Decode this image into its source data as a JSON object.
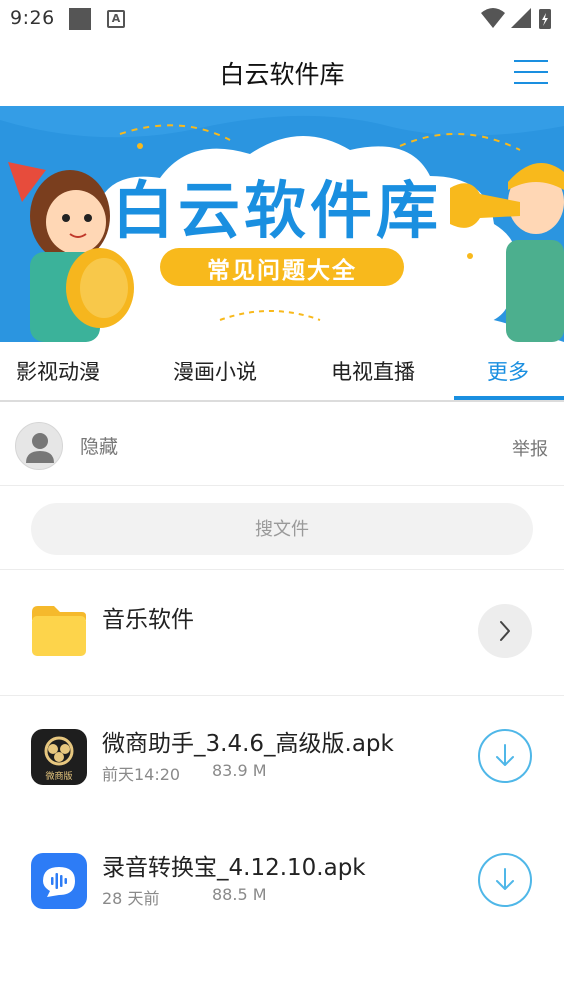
{
  "status_bar": {
    "time": "9:26",
    "notification_icon": "A"
  },
  "header": {
    "title": "白云软件库",
    "menu_icon": "hamburger-menu-icon"
  },
  "banner": {
    "title": "白云软件库",
    "subtitle": "常见问题大全",
    "colors": {
      "background": "#2b95e0",
      "title": "#1a8fe0",
      "pill": "#f8b91c"
    }
  },
  "tabs": [
    {
      "label": "影视动漫",
      "active": false
    },
    {
      "label": "漫画小说",
      "active": false
    },
    {
      "label": "电视直播",
      "active": false
    },
    {
      "label": "更多",
      "active": true
    }
  ],
  "user": {
    "name": "隐藏",
    "report_label": "举报"
  },
  "search": {
    "placeholder": "搜文件"
  },
  "folder": {
    "name": "音乐软件",
    "icon": "folder-icon"
  },
  "files": [
    {
      "name": "微商助手_3.4.6_高级版.apk",
      "time": "前天14:20",
      "size": "83.9 M",
      "icon_label": "微商版"
    },
    {
      "name": "录音转换宝_4.12.10.apk",
      "time": "28 天前",
      "size": "88.5 M"
    }
  ],
  "colors": {
    "accent": "#1a8fe0",
    "download": "#4fb7e8"
  }
}
